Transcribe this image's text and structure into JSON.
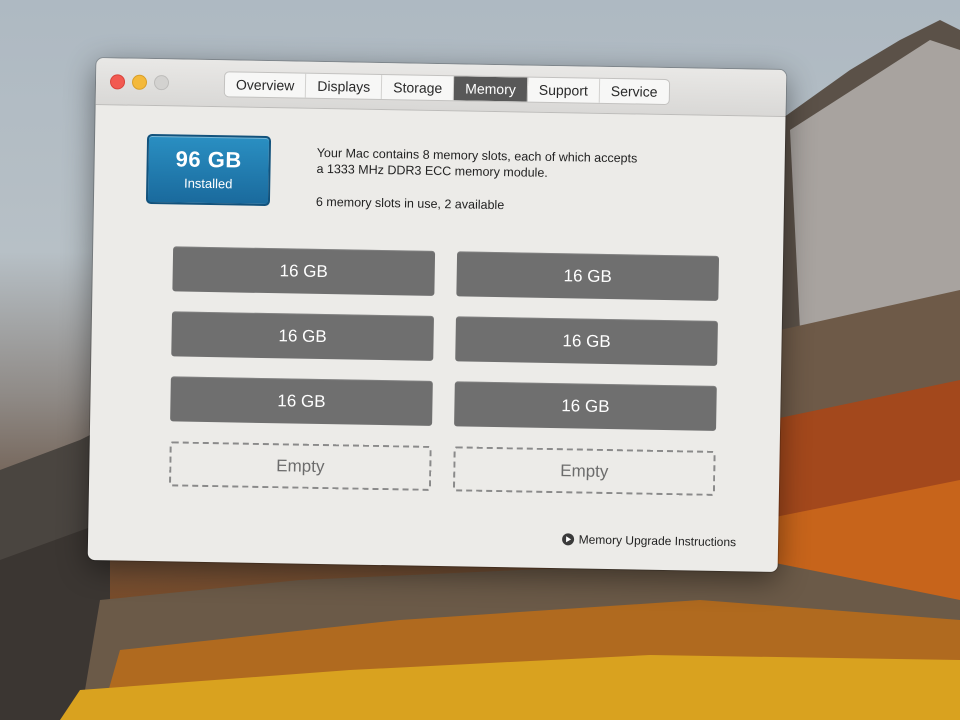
{
  "window": {
    "tabs": [
      {
        "label": "Overview",
        "active": false
      },
      {
        "label": "Displays",
        "active": false
      },
      {
        "label": "Storage",
        "active": false
      },
      {
        "label": "Memory",
        "active": true
      },
      {
        "label": "Support",
        "active": false
      },
      {
        "label": "Service",
        "active": false
      }
    ]
  },
  "memory": {
    "installed_size": "96 GB",
    "installed_label": "Installed",
    "description_line1": "Your Mac contains 8 memory slots, each of which accepts",
    "description_line2": "a 1333 MHz DDR3 ECC memory module.",
    "slots_status": "6 memory slots in use, 2 available",
    "slots": [
      {
        "label": "16 GB",
        "state": "filled"
      },
      {
        "label": "16 GB",
        "state": "filled"
      },
      {
        "label": "16 GB",
        "state": "filled"
      },
      {
        "label": "16 GB",
        "state": "filled"
      },
      {
        "label": "16 GB",
        "state": "filled"
      },
      {
        "label": "16 GB",
        "state": "filled"
      },
      {
        "label": "Empty",
        "state": "empty"
      },
      {
        "label": "Empty",
        "state": "empty"
      }
    ],
    "upgrade_link": "Memory Upgrade Instructions"
  },
  "colors": {
    "badge": "#1a6a9d",
    "slot_filled": "#6f6f6f",
    "active_tab": "#585858",
    "close_button": "#f25a51",
    "minimize_button": "#f4b93b"
  },
  "icons": {
    "upgrade_link": "right-arrow-circle-icon"
  }
}
